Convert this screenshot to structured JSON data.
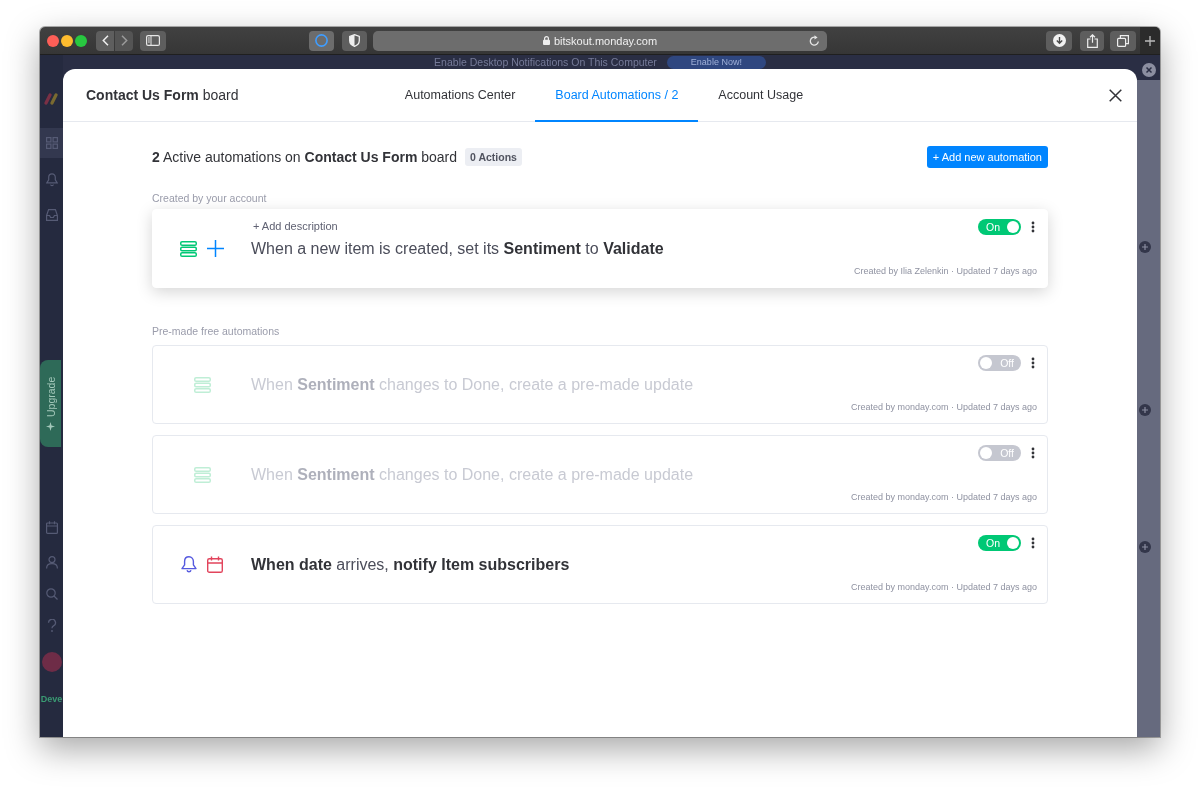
{
  "browser": {
    "url": "bitskout.monday.com"
  },
  "backdrop": {
    "banner_text": "Enable Desktop Notifications On This Computer",
    "banner_button": "Enable Now!",
    "upgrade": "Upgrade",
    "workspace": "Deve"
  },
  "modal": {
    "title": "**Contact Us Form** board",
    "tabs": [
      {
        "label": "Automations Center",
        "selected": false
      },
      {
        "label": "Board Automations / 2",
        "selected": true
      },
      {
        "label": "Account Usage",
        "selected": false
      }
    ]
  },
  "summary": {
    "text": "**2** Active automations on **Contact Us Form** board",
    "badge": "0 Actions",
    "add_button": "+ Add new automation"
  },
  "sections": [
    {
      "heading": "Created by your account",
      "automations": [
        {
          "kind": "item-created",
          "hovered": true,
          "description": "+ Add description",
          "sentence": "When a new item is created, set its **Sentiment** to **Validate**",
          "on": true,
          "toggle_label": "On",
          "meta": "Created by Ilia Zelenkin · Updated 7 days ago"
        }
      ]
    },
    {
      "heading": "Pre-made free automations",
      "automations": [
        {
          "kind": "status-change",
          "hovered": false,
          "sentence": "When **Sentiment** changes to Done, create a pre-made update",
          "on": false,
          "toggle_label": "Off",
          "meta": "Created by monday.com · Updated 7 days ago"
        },
        {
          "kind": "status-change",
          "hovered": false,
          "sentence": "When **Sentiment** changes to Done, create a pre-made update",
          "on": false,
          "toggle_label": "Off",
          "meta": "Created by monday.com · Updated 7 days ago"
        },
        {
          "kind": "date-arrives",
          "hovered": false,
          "sentence": "**When date** arrives, **notify Item subscribers**",
          "on": true,
          "toggle_label": "On",
          "meta": "Created by monday.com · Updated 7 days ago"
        }
      ]
    }
  ]
}
